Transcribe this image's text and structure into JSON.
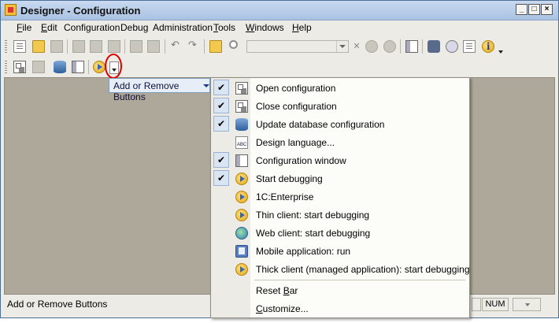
{
  "window": {
    "title": "Designer - Configuration"
  },
  "menubar": {
    "items": [
      {
        "label": "File",
        "accel": "F",
        "rest": "ile"
      },
      {
        "label": "Edit",
        "accel": "E",
        "rest": "dit"
      },
      {
        "label": "Configuration",
        "accel": "",
        "rest": "Configuration"
      },
      {
        "label": "Debug",
        "accel": "",
        "rest": "Debug"
      },
      {
        "label": "Administration",
        "accel": "",
        "rest": "Administration"
      },
      {
        "label": "Tools",
        "accel": "T",
        "rest": "ools"
      },
      {
        "label": "Windows",
        "accel": "W",
        "rest": "indows"
      },
      {
        "label": "Help",
        "accel": "H",
        "rest": "elp"
      }
    ]
  },
  "toolbar_popup": {
    "label": "Add or Remove Buttons"
  },
  "context_menu": {
    "items": [
      {
        "label": "Open configuration",
        "checked": true,
        "icon": "open-config-icon"
      },
      {
        "label": "Close configuration",
        "checked": true,
        "icon": "close-config-icon"
      },
      {
        "label": "Update database configuration",
        "checked": true,
        "icon": "update-db-icon"
      },
      {
        "label": "Design language...",
        "checked": false,
        "icon": "design-language-icon"
      },
      {
        "label": "Configuration window",
        "checked": true,
        "icon": "config-window-icon"
      },
      {
        "label": "Start debugging",
        "checked": true,
        "icon": "start-debug-icon"
      },
      {
        "label": "1C:Enterprise",
        "checked": false,
        "icon": "enterprise-icon"
      },
      {
        "label": "Thin client: start debugging",
        "checked": false,
        "icon": "thin-client-icon"
      },
      {
        "label": "Web client: start debugging",
        "checked": false,
        "icon": "web-client-icon"
      },
      {
        "label": "Mobile application: run",
        "checked": false,
        "icon": "mobile-app-icon"
      },
      {
        "label": "Thick client (managed application): start debugging",
        "checked": false,
        "icon": "thick-client-icon"
      }
    ],
    "footer": [
      {
        "label": "Reset Bar",
        "accel": "B"
      },
      {
        "label": "Customize...",
        "accel": "C"
      }
    ],
    "check_mark": "✔"
  },
  "statusbar": {
    "text": "Add or Remove Buttons",
    "num": "NUM"
  }
}
